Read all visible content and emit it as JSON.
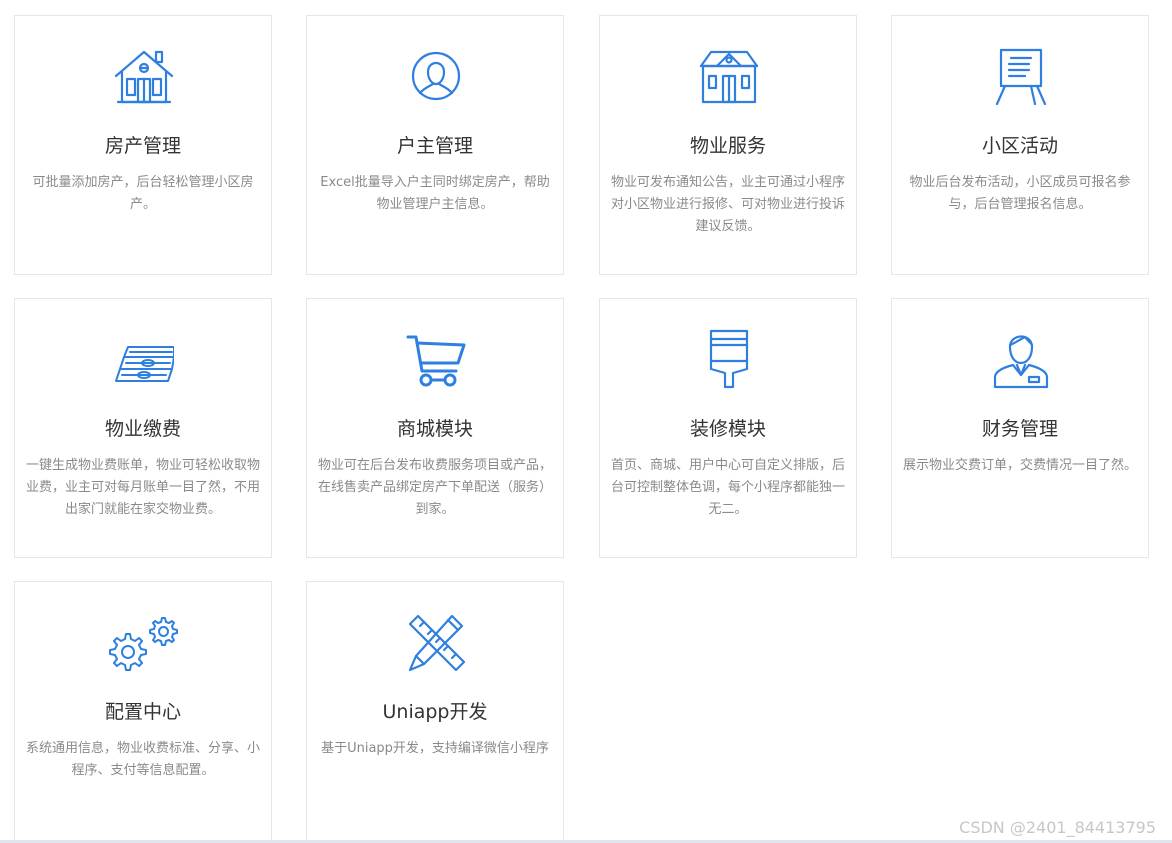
{
  "accent": "#2f7fe0",
  "cards": [
    {
      "title": "房产管理",
      "desc": "可批量添加房产，后台轻松管理小区房产。",
      "icon": "house-icon"
    },
    {
      "title": "户主管理",
      "desc": "Excel批量导入户主同时绑定房产，帮助物业管理户主信息。",
      "icon": "user-avatar-icon"
    },
    {
      "title": "物业服务",
      "desc": "物业可发布通知公告，业主可通过小程序对小区物业进行报修、可对物业进行投诉建议反馈。",
      "icon": "building-icon"
    },
    {
      "title": "小区活动",
      "desc": "物业后台发布活动，小区成员可报名参与，后台管理报名信息。",
      "icon": "easel-board-icon"
    },
    {
      "title": "物业缴费",
      "desc": "一键生成物业费账单，物业可轻松收取物业费，业主可对每月账单一目了然，不用出家门就能在家交物业费。",
      "icon": "money-stack-icon"
    },
    {
      "title": "商城模块",
      "desc": "物业可在后台发布收费服务项目或产品，在线售卖产品绑定房产下单配送（服务）到家。",
      "icon": "shopping-cart-icon"
    },
    {
      "title": "装修模块",
      "desc": "首页、商城、用户中心可自定义排版，后台可控制整体色调，每个小程序都能独一无二。",
      "icon": "paint-brush-icon"
    },
    {
      "title": "财务管理",
      "desc": "展示物业交费订单，交费情况一目了然。",
      "icon": "accountant-icon"
    },
    {
      "title": "配置中心",
      "desc": "系统通用信息，物业收费标准、分享、小程序、支付等信息配置。",
      "icon": "gears-icon"
    },
    {
      "title": "Uniapp开发",
      "desc": "基于Uniapp开发，支持编译微信小程序",
      "icon": "ruler-pencil-icon"
    }
  ],
  "watermark": "CSDN @2401_84413795"
}
